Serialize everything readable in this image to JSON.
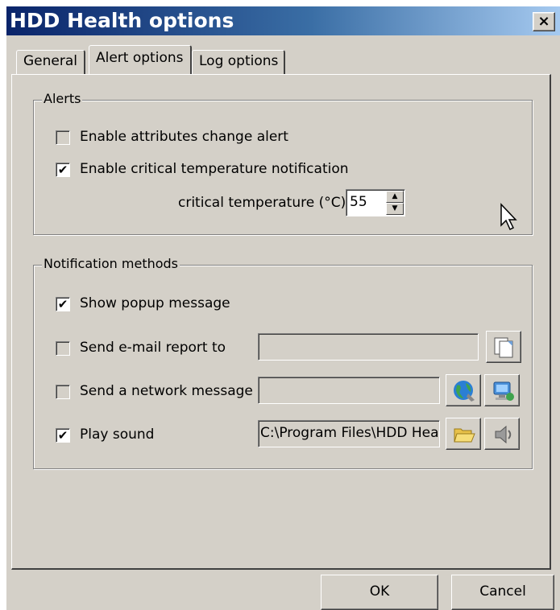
{
  "window": {
    "title": "HDD Health options",
    "close_label": "×"
  },
  "tabs": [
    {
      "label": "General",
      "active": false
    },
    {
      "label": "Alert options",
      "active": true
    },
    {
      "label": "Log options",
      "active": false
    }
  ],
  "alerts": {
    "legend": "Alerts",
    "attributes_change": {
      "label": "Enable attributes change alert",
      "checked": false
    },
    "critical_temp": {
      "label": "Enable critical temperature notification",
      "checked": true
    },
    "temp_label": "critical temperature (°C)",
    "temp_value": "55"
  },
  "notification": {
    "legend": "Notification methods",
    "popup": {
      "label": "Show popup message",
      "checked": true
    },
    "email": {
      "label": "Send e-mail report to",
      "checked": false,
      "value": "",
      "button_icon": "copy-icon"
    },
    "network": {
      "label": "Send a network message",
      "checked": false,
      "value": "",
      "icons": [
        "globe-icon",
        "network-computer-icon"
      ]
    },
    "sound": {
      "label": "Play sound",
      "checked": true,
      "value": "C:\\Program Files\\HDD Hea",
      "icons": [
        "folder-open-icon",
        "speaker-icon"
      ]
    }
  },
  "buttons": {
    "ok": "OK",
    "cancel": "Cancel"
  },
  "colors": {
    "titlebar_start": "#0a246a",
    "titlebar_end": "#a6caf0",
    "face": "#d4d0c8"
  }
}
